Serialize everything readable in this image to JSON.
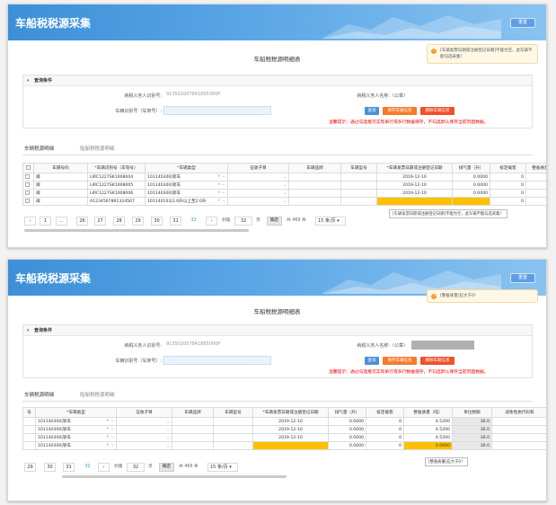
{
  "header": {
    "title": "车船税税源采集",
    "button": "重置"
  },
  "page_title": "车船税税源明细表",
  "query": {
    "section": "查询条件",
    "taxpayer_id_label": "纳税义务人识别号:",
    "taxpayer_id_value": "913502007841865000P",
    "taxpayer_name_label": "纳税义务人名称:（公章）",
    "vin_label": "车辆识别号（车架号）:",
    "btn_query": "查询",
    "btn_save": "保存车辆信息",
    "btn_delete": "删除车辆信息",
    "notice": "温馨提示：通过勾选框可实现单行或多行数据保存，不勾选默认保存当前页面数据。"
  },
  "tabs": {
    "vehicle": "车辆税源明细",
    "vessel": "船舶税税源明细"
  },
  "panel1": {
    "toast": "[车辆发票日期或注册登记日期]不能为空，此车辆不能勾选采集！",
    "headers": [
      "车辆号码",
      "*车辆识别号（车架号）",
      "*车辆类型",
      "征收子目",
      "车辆品牌",
      "车辆型号",
      "*车辆发票日期或注册登记日期",
      "排气量（升）",
      "核定载客",
      "整备质量"
    ],
    "rows": [
      {
        "plate": "闽",
        "vin": "LIRC1227SK1008004",
        "type": "101140300|轿车",
        "date": "2019-12-10",
        "disp": "0.0000",
        "seat": "0"
      },
      {
        "plate": "闽",
        "vin": "LIRC1227SK1008005",
        "type": "101140300|轿车",
        "date": "2019-12-10",
        "disp": "0.0000",
        "seat": "0"
      },
      {
        "plate": "闽",
        "vin": "LIRC1227SK1008006",
        "type": "101140300|轿车",
        "date": "2019-12-10",
        "disp": "0.0000",
        "seat": "0"
      },
      {
        "plate": "闽",
        "vin": "A1234567891324567",
        "type": "101140103|1.6升以上至2.0升",
        "date": "",
        "disp": "",
        "seat": "0"
      }
    ],
    "tooltip": "[车辆发票日期或注册登记日期]不能为空，此车辆不能勾选采集！",
    "pages": [
      "1",
      "...",
      "26",
      "27",
      "28",
      "29",
      "30",
      "31",
      "32"
    ],
    "goto_label": "到第",
    "goto_value": "32",
    "page_unit": "页",
    "confirm": "确定",
    "total": "共 469 条",
    "per_page": "15 条/页"
  },
  "panel2": {
    "toast": "[整备质量]应大于0！",
    "headers": [
      "*车辆类型",
      "征收子目",
      "车辆品牌",
      "车辆型号",
      "*车辆发票日期或注册登记日期",
      "排气量（升）",
      "核定载客",
      "整备质量（吨）",
      "单位税额",
      "减免性质代码和"
    ],
    "rows": [
      {
        "type": "101140300|轿车",
        "date": "2019-12-10",
        "disp": "0.0000",
        "seat": "0",
        "weight": "4.5200",
        "tax": "36.0"
      },
      {
        "type": "101140300|轿车",
        "date": "2019-12-10",
        "disp": "0.0000",
        "seat": "0",
        "weight": "4.5200",
        "tax": "36.0"
      },
      {
        "type": "101140300|轿车",
        "date": "2019-12-10",
        "disp": "0.0000",
        "seat": "0",
        "weight": "4.5200",
        "tax": "36.0"
      },
      {
        "type": "101140300|轿车",
        "date": "",
        "disp": "0.0000",
        "seat": "0",
        "weight": "0.0000",
        "tax": "36.0"
      }
    ],
    "tooltip": "[整备质量]应大于0！",
    "pages": [
      "29",
      "30",
      "31",
      "32"
    ],
    "goto_label": "到第",
    "goto_value": "32",
    "page_unit": "页",
    "confirm": "确定",
    "total": "共 469 条",
    "per_page": "15 条/页"
  },
  "colors": {
    "accent": "#3d8fd8",
    "warning": "#ffc000",
    "danger": "#e00000",
    "orange_btn": "#f57c2b"
  }
}
